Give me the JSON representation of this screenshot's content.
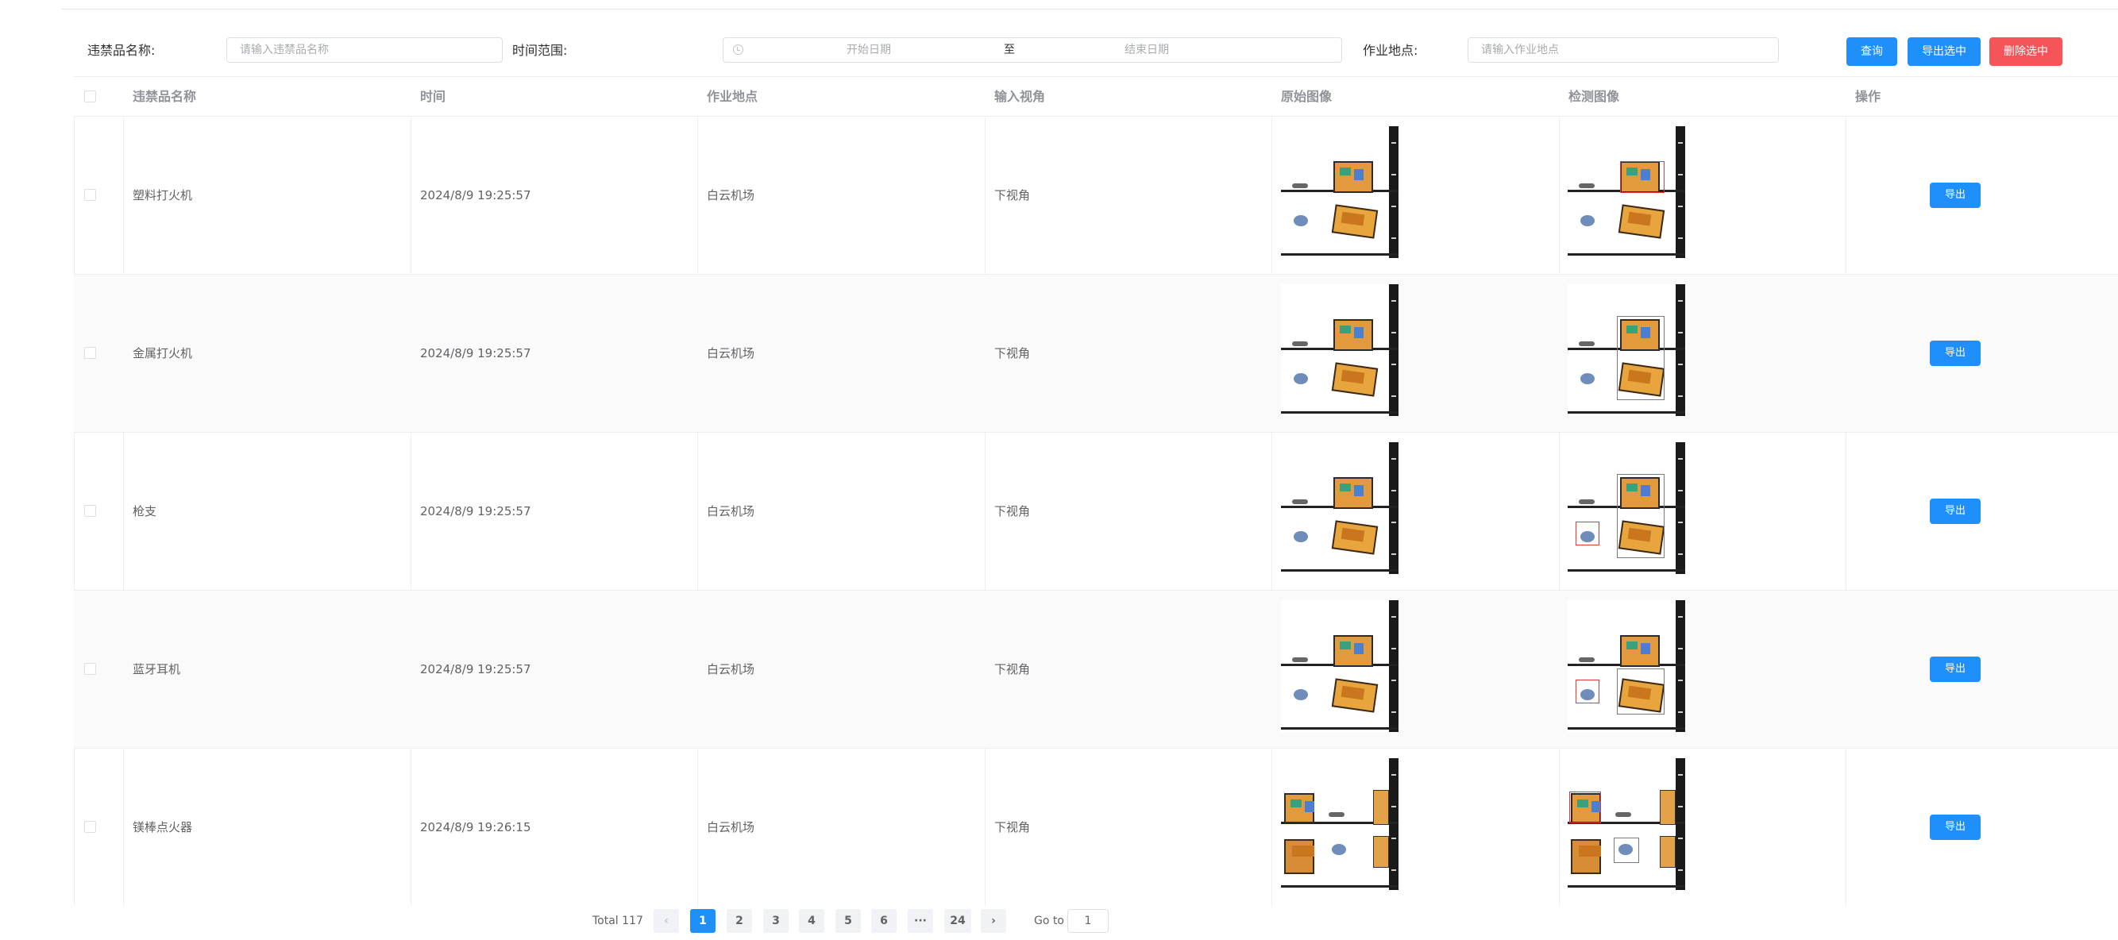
{
  "filters": {
    "name_label": "违禁品名称:",
    "name_placeholder": "请输入违禁品名称",
    "time_label": "时间范围:",
    "start_placeholder": "开始日期",
    "range_separator": "至",
    "end_placeholder": "结束日期",
    "location_label": "作业地点:",
    "location_placeholder": "请输入作业地点"
  },
  "toolbar": {
    "query_label": "查询",
    "export_selected_label": "导出选中",
    "delete_selected_label": "删除选中"
  },
  "table": {
    "columns": [
      "违禁品名称",
      "时间",
      "作业地点",
      "输入视角",
      "原始图像",
      "检测图像",
      "操作"
    ],
    "rows": [
      {
        "name": "塑料打火机",
        "time": "2024/8/9 19:25:57",
        "location": "白云机场",
        "view": "下视角",
        "action": "导出"
      },
      {
        "name": "金属打火机",
        "time": "2024/8/9 19:25:57",
        "location": "白云机场",
        "view": "下视角",
        "action": "导出"
      },
      {
        "name": "枪支",
        "time": "2024/8/9 19:25:57",
        "location": "白云机场",
        "view": "下视角",
        "action": "导出"
      },
      {
        "name": "蓝牙耳机",
        "time": "2024/8/9 19:25:57",
        "location": "白云机场",
        "view": "下视角",
        "action": "导出"
      },
      {
        "name": "镁棒点火器",
        "time": "2024/8/9 19:26:15",
        "location": "白云机场",
        "view": "下视角",
        "action": "导出"
      }
    ]
  },
  "pagination": {
    "total_text": "Total 117",
    "pages": [
      "1",
      "2",
      "3",
      "4",
      "5",
      "6",
      "···",
      "24"
    ],
    "current": "1",
    "prev_icon": "‹",
    "next_icon": "›",
    "goto_label": "Go to",
    "goto_value": "1"
  },
  "colors": {
    "primary": "#1e8ffb",
    "danger": "#f55558",
    "border": "#ebeef5",
    "stripe": "#fafafa"
  }
}
